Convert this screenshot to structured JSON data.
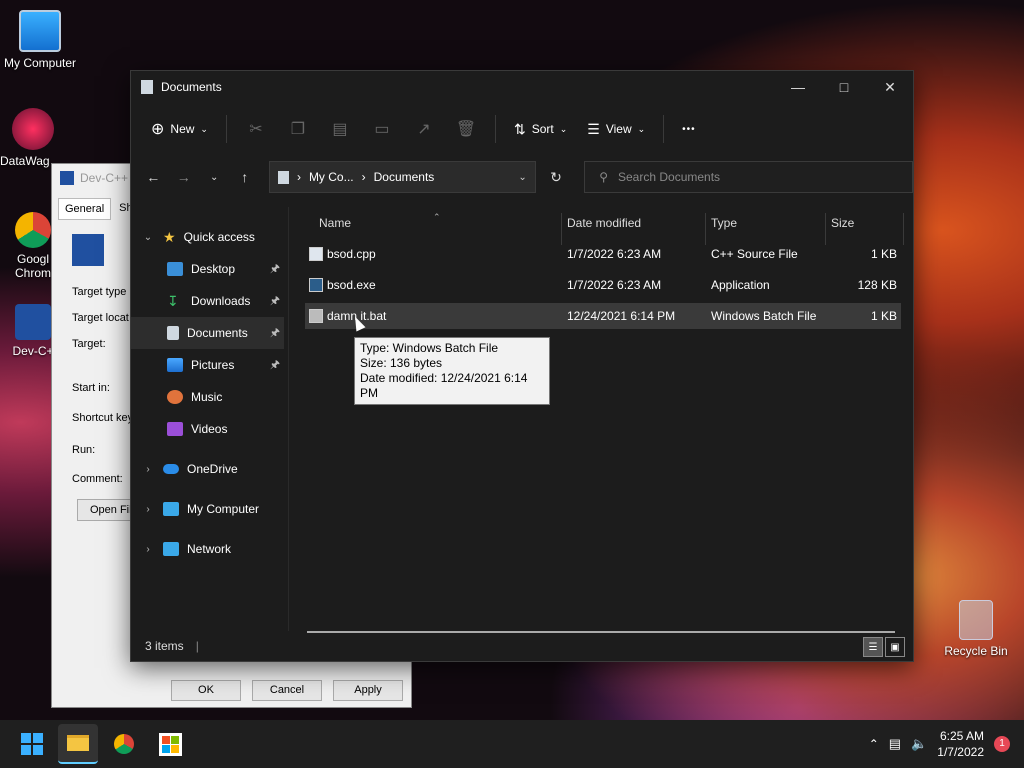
{
  "desktop": {
    "icons": [
      {
        "label": "My Computer"
      },
      {
        "label": "DataWag"
      },
      {
        "label": "Googl Chrom"
      },
      {
        "label": "Dev-C+"
      }
    ],
    "recycle_bin": "Recycle Bin"
  },
  "properties_window": {
    "title": "Dev-C++",
    "tabs": [
      "General",
      "Sho"
    ],
    "rows": [
      "Target type",
      "Target locat",
      "Target:",
      "Start in:",
      "Shortcut key",
      "Run:",
      "Comment:"
    ],
    "open_file_btn": "Open Fil",
    "ok": "OK",
    "cancel": "Cancel",
    "apply": "Apply"
  },
  "explorer": {
    "title": "Documents",
    "toolbar": {
      "new": "New",
      "sort": "Sort",
      "view": "View",
      "more": "•••"
    },
    "address": {
      "crumb1": "My Co...",
      "crumb2": "Documents"
    },
    "search": {
      "placeholder": "Search Documents"
    },
    "sidebar": {
      "quick_access": "Quick access",
      "items": [
        {
          "label": "Desktop",
          "pinned": true
        },
        {
          "label": "Downloads",
          "pinned": true
        },
        {
          "label": "Documents",
          "pinned": true
        },
        {
          "label": "Pictures",
          "pinned": true
        },
        {
          "label": "Music",
          "pinned": false
        },
        {
          "label": "Videos",
          "pinned": false
        }
      ],
      "onedrive": "OneDrive",
      "my_computer": "My Computer",
      "network": "Network"
    },
    "columns": {
      "name": "Name",
      "date": "Date modified",
      "type": "Type",
      "size": "Size"
    },
    "files": [
      {
        "name": "bsod.cpp",
        "date": "1/7/2022 6:23 AM",
        "type": "C++ Source File",
        "size": "1 KB"
      },
      {
        "name": "bsod.exe",
        "date": "1/7/2022 6:23 AM",
        "type": "Application",
        "size": "128 KB"
      },
      {
        "name": "damn it.bat",
        "date": "12/24/2021 6:14 PM",
        "type": "Windows Batch File",
        "size": "1 KB"
      }
    ],
    "tooltip": {
      "line1": "Type: Windows Batch File",
      "line2": "Size: 136 bytes",
      "line3": "Date modified: 12/24/2021 6:14 PM"
    },
    "status": "3 items"
  },
  "taskbar": {
    "time": "6:25 AM",
    "date": "1/7/2022",
    "notifications": "1"
  }
}
